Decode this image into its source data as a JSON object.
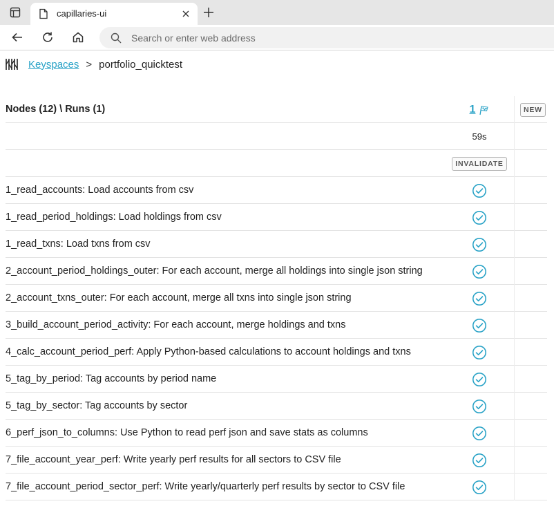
{
  "browser": {
    "tab_title": "capillaries-ui",
    "address_placeholder": "Search or enter web address"
  },
  "breadcrumb": {
    "root": "Keyspaces",
    "separator": ">",
    "current": "portfolio_quicktest"
  },
  "table": {
    "header": "Nodes (12) \\ Runs (1)",
    "run_id": "1",
    "new_button": "NEW",
    "duration": "59s",
    "invalidate_button": "INVALIDATE",
    "nodes": [
      {
        "label": "1_read_accounts: Load accounts from csv",
        "status": "complete"
      },
      {
        "label": "1_read_period_holdings: Load holdings from csv",
        "status": "complete"
      },
      {
        "label": "1_read_txns: Load txns from csv",
        "status": "complete"
      },
      {
        "label": "2_account_period_holdings_outer: For each account, merge all holdings into single json string",
        "status": "complete"
      },
      {
        "label": "2_account_txns_outer: For each account, merge all txns into single json string",
        "status": "complete"
      },
      {
        "label": "3_build_account_period_activity: For each account, merge holdings and txns",
        "status": "complete"
      },
      {
        "label": "4_calc_account_period_perf: Apply Python-based calculations to account holdings and txns",
        "status": "complete"
      },
      {
        "label": "5_tag_by_period: Tag accounts by period name",
        "status": "complete"
      },
      {
        "label": "5_tag_by_sector: Tag accounts by sector",
        "status": "complete"
      },
      {
        "label": "6_perf_json_to_columns: Use Python to read perf json and save stats as columns",
        "status": "complete"
      },
      {
        "label": "7_file_account_year_perf: Write yearly perf results for all sectors to CSV file",
        "status": "complete"
      },
      {
        "label": "7_file_account_period_sector_perf: Write yearly/quarterly perf results by sector to CSV file",
        "status": "complete"
      }
    ]
  },
  "colors": {
    "accent": "#2aa3c7",
    "check": "#2aa3c7"
  }
}
